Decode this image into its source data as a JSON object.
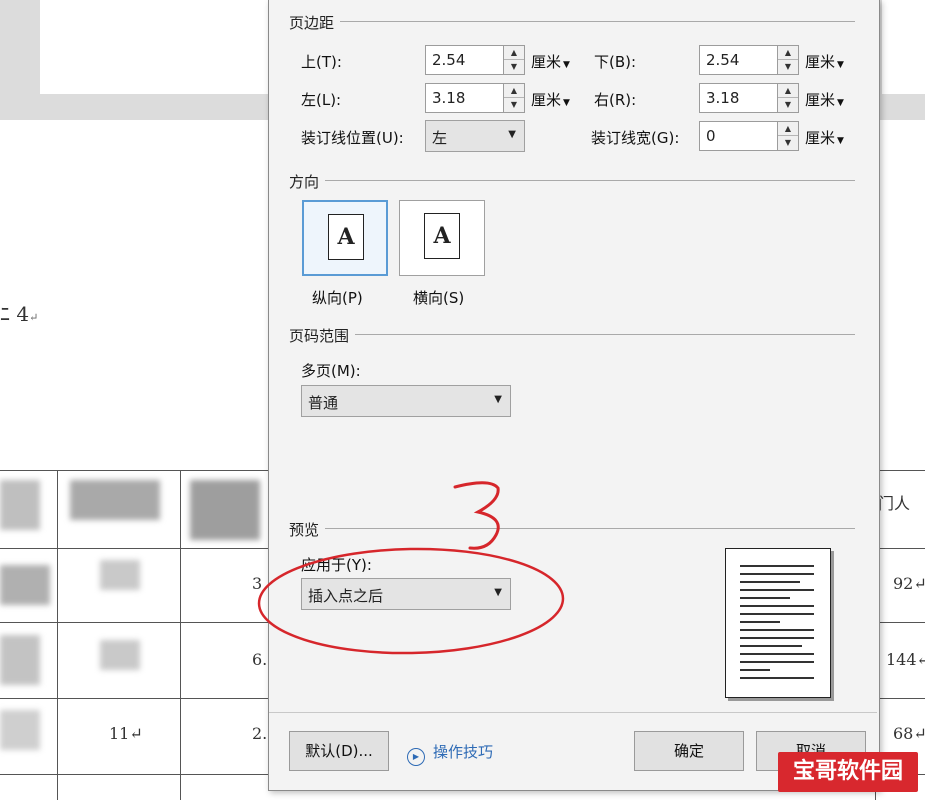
{
  "document": {
    "text_fragment": "ﾆ 4",
    "paragraph_mark": "↵",
    "table_header_right": "门人",
    "table_values_right": [
      "92↵",
      "144↵",
      "68↵"
    ],
    "table_values_left": [
      "11↵"
    ],
    "table_values_mid": [
      "3",
      "6.",
      "2."
    ]
  },
  "dialog": {
    "margins": {
      "title": "页边距",
      "top_label": "上(T):",
      "top_value": "2.54",
      "bottom_label": "下(B):",
      "bottom_value": "2.54",
      "left_label": "左(L):",
      "left_value": "3.18",
      "right_label": "右(R):",
      "right_value": "3.18",
      "gutter_pos_label": "装订线位置(U):",
      "gutter_pos_value": "左",
      "gutter_width_label": "装订线宽(G):",
      "gutter_width_value": "0",
      "unit": "厘米"
    },
    "orientation": {
      "title": "方向",
      "portrait_label": "纵向(P)",
      "landscape_label": "横向(S)",
      "glyph": "A",
      "selected": "portrait"
    },
    "page_range": {
      "title": "页码范围",
      "multiple_label": "多页(M):",
      "multiple_value": "普通"
    },
    "preview": {
      "title": "预览",
      "apply_label": "应用于(Y):",
      "apply_value": "插入点之后"
    },
    "footer": {
      "default_button": "默认(D)...",
      "tips_link": "操作技巧",
      "ok_button": "确定",
      "cancel_button": "取消"
    }
  },
  "annotation": {
    "number": "3",
    "color": "#d6262b"
  },
  "watermark": {
    "text": "宝哥软件园",
    "color": "#d8282e"
  }
}
